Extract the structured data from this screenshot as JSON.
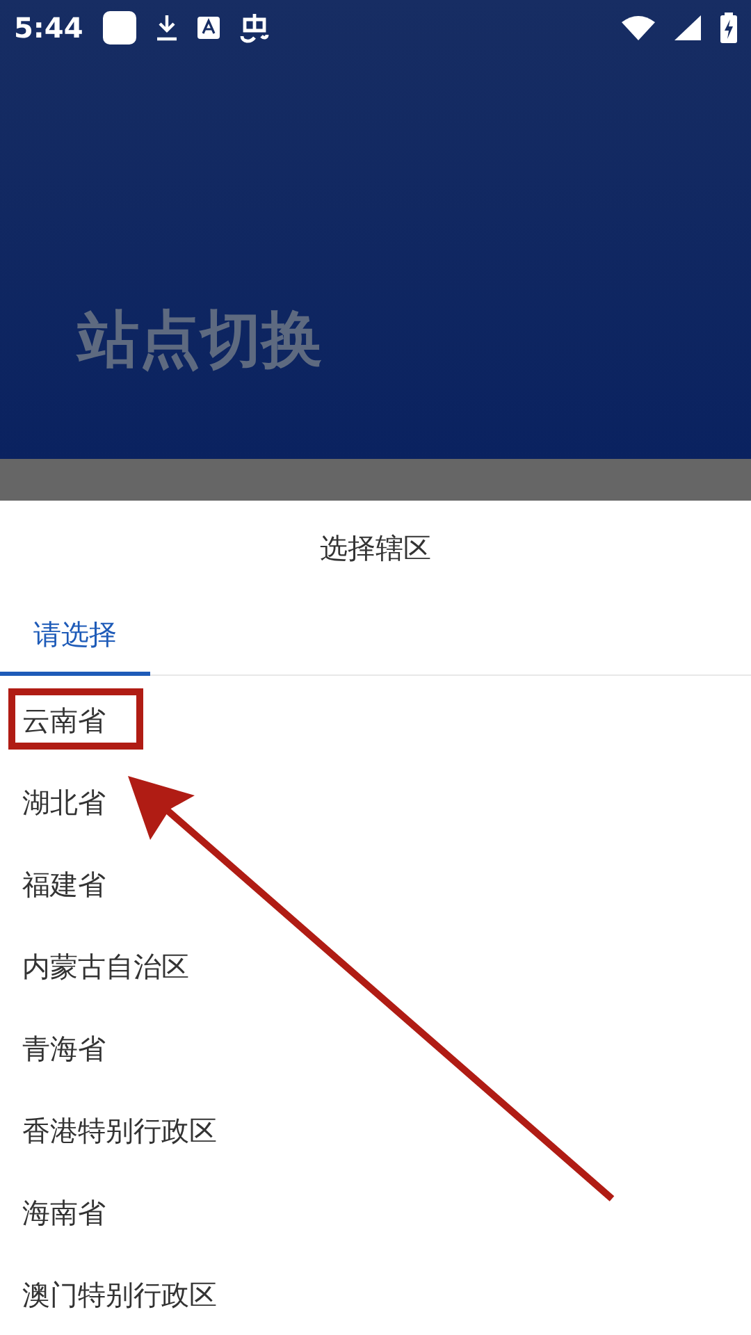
{
  "status_bar": {
    "time": "5:44"
  },
  "header": {
    "title": "站点切换"
  },
  "sheet": {
    "title": "选择辖区",
    "tabs": [
      {
        "label": "请选择",
        "selected": true
      }
    ],
    "items": [
      {
        "label": "云南省"
      },
      {
        "label": "湖北省"
      },
      {
        "label": "福建省"
      },
      {
        "label": "内蒙古自治区"
      },
      {
        "label": "青海省"
      },
      {
        "label": "香港特别行政区"
      },
      {
        "label": "海南省"
      },
      {
        "label": "澳门特别行政区"
      }
    ]
  }
}
